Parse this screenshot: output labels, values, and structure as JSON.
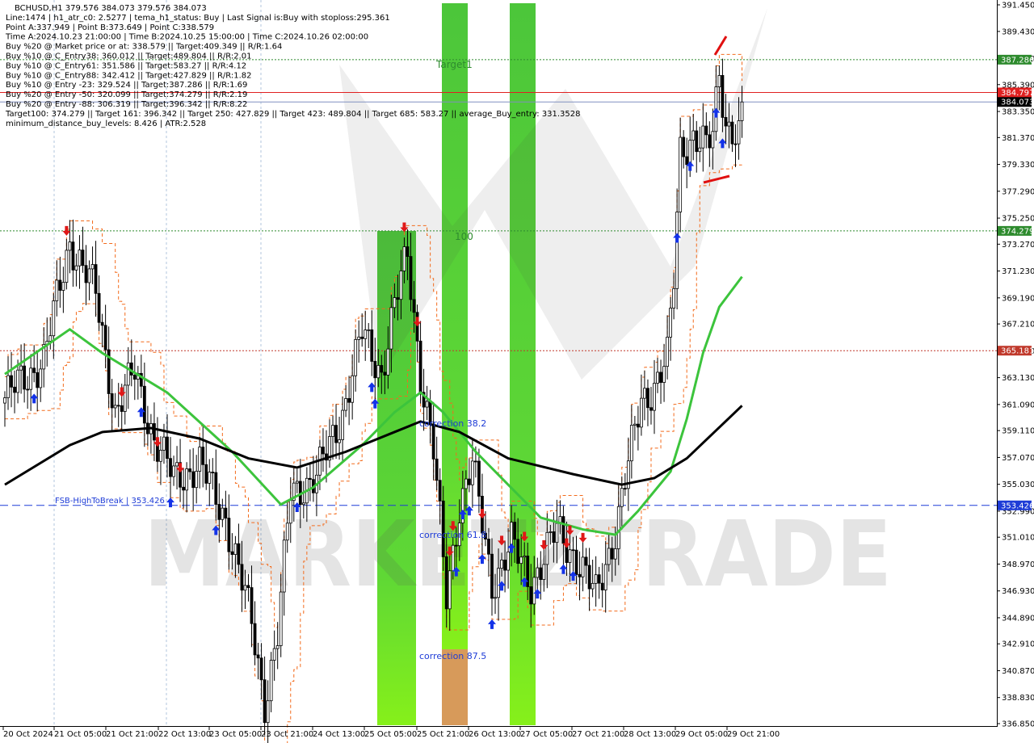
{
  "info_lines": [
    "BCHUSD,H1  379.576 384.073 379.576 384.073",
    "Line:1474 | h1_atr_c0: 2.5277 | tema_h1_status: Buy | Last Signal is:Buy with stoploss:295.361",
    "Point A:337.949 | Point B:373.649 | Point C:338.579",
    "Time A:2024.10.23 21:00:00 | Time B:2024.10.25 15:00:00 | Time C:2024.10.26 02:00:00",
    "Buy %20 @ Market price or at: 338.579 || Target:409.349 || R/R:1.64",
    "Buy %10 @ C_Entry38: 360.012 || Target:489.804 || R/R:2.01",
    "Buy %10 @ C_Entry61: 351.586 || Target:583.27 || R/R:4.12",
    "Buy %10 @ C_Entry88: 342.412 || Target:427.829 || R/R:1.82",
    "Buy %10 @ Entry -23: 329.524 || Target:387.286 || R/R:1.69",
    "Buy %20 @ Entry -50: 320.099 || Target:374.279 || R/R:2.19",
    "Buy %20 @ Entry -88: 306.319 || Target:396.342 || R/R:8.22",
    "Target100: 374.279 || Target 161: 396.342 || Target 250: 427.829 || Target 423: 489.804 || Target 685: 583.27 || average_Buy_entry: 331.3528",
    "minimum_distance_buy_levels: 8.426 | ATR:2.528"
  ],
  "labels": {
    "target1": "Target1",
    "level100": "100",
    "correction382": "correction 38.2",
    "correction618": "correction 61.8",
    "correction875": "correction 87.5",
    "fsb": "FSB-HighToBreak | 353.426",
    "watermark": "MARKETZTRADE"
  },
  "price_tags": [
    {
      "value": "387.286",
      "price": 387.286,
      "color": "#2e8b2e"
    },
    {
      "value": "384.797",
      "price": 384.797,
      "color": "#e02020"
    },
    {
      "value": "384.073",
      "price": 384.073,
      "color": "#000000"
    },
    {
      "value": "374.279",
      "price": 374.279,
      "color": "#2e8b2e"
    },
    {
      "value": "365.181",
      "price": 365.181,
      "color": "#c0392b"
    },
    {
      "value": "353.426",
      "price": 353.426,
      "color": "#1e3cd7"
    }
  ],
  "chart_data": {
    "type": "candlestick",
    "symbol": "BCHUSD",
    "timeframe": "H1",
    "ylim": [
      336.85,
      391.45
    ],
    "y_ticks": [
      "391.450",
      "389.430",
      "387.370",
      "385.390",
      "383.350",
      "381.370",
      "379.330",
      "377.290",
      "375.250",
      "373.270",
      "371.230",
      "369.190",
      "367.210",
      "365.170",
      "363.130",
      "361.090",
      "359.110",
      "357.070",
      "355.030",
      "352.990",
      "351.010",
      "348.970",
      "346.930",
      "344.890",
      "342.910",
      "340.870",
      "338.830",
      "336.850"
    ],
    "x_ticks": [
      "20 Oct 2024",
      "21 Oct 05:00",
      "21 Oct 21:00",
      "22 Oct 13:00",
      "23 Oct 05:00",
      "23 Oct 21:00",
      "24 Oct 13:00",
      "25 Oct 05:00",
      "25 Oct 21:00",
      "26 Oct 13:00",
      "27 Oct 05:00",
      "27 Oct 21:00",
      "28 Oct 13:00",
      "29 Oct 05:00",
      "29 Oct 21:00"
    ],
    "anchors": [
      [
        0,
        361.6
      ],
      [
        12,
        364.5
      ],
      [
        20,
        373.5
      ],
      [
        28,
        369.5
      ],
      [
        34,
        360.5
      ],
      [
        40,
        363.5
      ],
      [
        46,
        358.5
      ],
      [
        52,
        355.5
      ],
      [
        60,
        356.5
      ],
      [
        68,
        352.5
      ],
      [
        76,
        344.5
      ],
      [
        80,
        338.5
      ],
      [
        84,
        343.5
      ],
      [
        88,
        354.5
      ],
      [
        96,
        355.5
      ],
      [
        104,
        360.5
      ],
      [
        110,
        366.5
      ],
      [
        116,
        363.5
      ],
      [
        120,
        368.5
      ],
      [
        124,
        372.5
      ],
      [
        128,
        363.5
      ],
      [
        132,
        357.5
      ],
      [
        136,
        346.5
      ],
      [
        140,
        353.5
      ],
      [
        144,
        356.5
      ],
      [
        150,
        347.5
      ],
      [
        156,
        350.5
      ],
      [
        162,
        347.5
      ],
      [
        170,
        351.5
      ],
      [
        176,
        349.5
      ],
      [
        182,
        346.5
      ],
      [
        188,
        351.5
      ],
      [
        192,
        356.5
      ],
      [
        196,
        361.5
      ],
      [
        200,
        362.5
      ],
      [
        204,
        364.5
      ],
      [
        206,
        370.5
      ],
      [
        208,
        380.5
      ],
      [
        212,
        381.5
      ],
      [
        216,
        380.5
      ],
      [
        218,
        381.5
      ],
      [
        220,
        386.5
      ],
      [
        222,
        382.5
      ],
      [
        226,
        381.5
      ],
      [
        227,
        384.073
      ]
    ],
    "horizontal_levels": [
      {
        "name": "Target1",
        "price": 387.286,
        "style": "dotted",
        "color": "#2e8b2e"
      },
      {
        "price": 384.797,
        "style": "solid",
        "color": "#e02020"
      },
      {
        "price": 384.073,
        "style": "solid",
        "color": "#8090c0"
      },
      {
        "name": "100",
        "price": 374.279,
        "style": "dotted",
        "color": "#2e8b2e"
      },
      {
        "price": 365.181,
        "style": "dotted",
        "color": "#c0392b"
      },
      {
        "name": "FSB-HighToBreak",
        "price": 353.426,
        "style": "dashed",
        "color": "#1e3cd7"
      }
    ],
    "ma_fast_points": [
      [
        0,
        363.4
      ],
      [
        20,
        366.8
      ],
      [
        30,
        365.0
      ],
      [
        50,
        362.0
      ],
      [
        70,
        357.5
      ],
      [
        85,
        353.5
      ],
      [
        95,
        354.8
      ],
      [
        110,
        358.0
      ],
      [
        120,
        360.5
      ],
      [
        128,
        362.0
      ],
      [
        135,
        360.5
      ],
      [
        145,
        357.5
      ],
      [
        155,
        355.0
      ],
      [
        165,
        352.5
      ],
      [
        178,
        351.6
      ],
      [
        188,
        351.2
      ],
      [
        195,
        353.0
      ],
      [
        205,
        356.0
      ],
      [
        210,
        360.0
      ],
      [
        215,
        365.0
      ],
      [
        220,
        368.5
      ],
      [
        227,
        370.8
      ]
    ],
    "ma_slow_points": [
      [
        0,
        355.0
      ],
      [
        20,
        358.0
      ],
      [
        30,
        359.0
      ],
      [
        45,
        359.3
      ],
      [
        60,
        358.5
      ],
      [
        75,
        357.0
      ],
      [
        90,
        356.3
      ],
      [
        105,
        357.5
      ],
      [
        120,
        359.0
      ],
      [
        128,
        359.8
      ],
      [
        140,
        359.0
      ],
      [
        155,
        357.0
      ],
      [
        175,
        355.8
      ],
      [
        190,
        355.0
      ],
      [
        200,
        355.5
      ],
      [
        210,
        357.0
      ],
      [
        227,
        361.0
      ]
    ],
    "buy_arrows": [
      9,
      42,
      51,
      65,
      80,
      90,
      113,
      114,
      139,
      141,
      143,
      147,
      150,
      153,
      156,
      160,
      164,
      172,
      175,
      207,
      211,
      219,
      221
    ],
    "sell_arrows": [
      19,
      36,
      47,
      54,
      123,
      127,
      137,
      138,
      147,
      153,
      160,
      166,
      173,
      174,
      178
    ]
  }
}
